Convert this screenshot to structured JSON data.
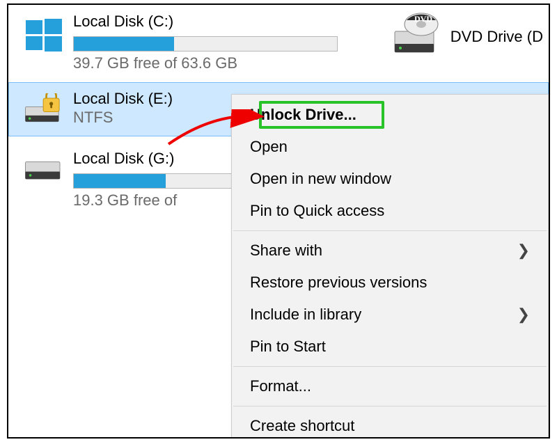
{
  "drive_c": {
    "title": "Local Disk (C:)",
    "free_text": "39.7 GB free of 63.6 GB",
    "bar_fill_percent": 38
  },
  "drive_e": {
    "title": "Local Disk (E:)",
    "fs": "NTFS"
  },
  "drive_g": {
    "title": "Local Disk (G:)",
    "free_text": "19.3 GB free of",
    "bar_fill_percent": 35
  },
  "dvd": {
    "title": "DVD Drive (D"
  },
  "menu": {
    "unlock": "Unlock Drive...",
    "open": "Open",
    "open_new": "Open in new window",
    "pin_quick": "Pin to Quick access",
    "share": "Share with",
    "restore": "Restore previous versions",
    "include": "Include in library",
    "pin_start": "Pin to Start",
    "format": "Format...",
    "shortcut": "Create shortcut"
  }
}
